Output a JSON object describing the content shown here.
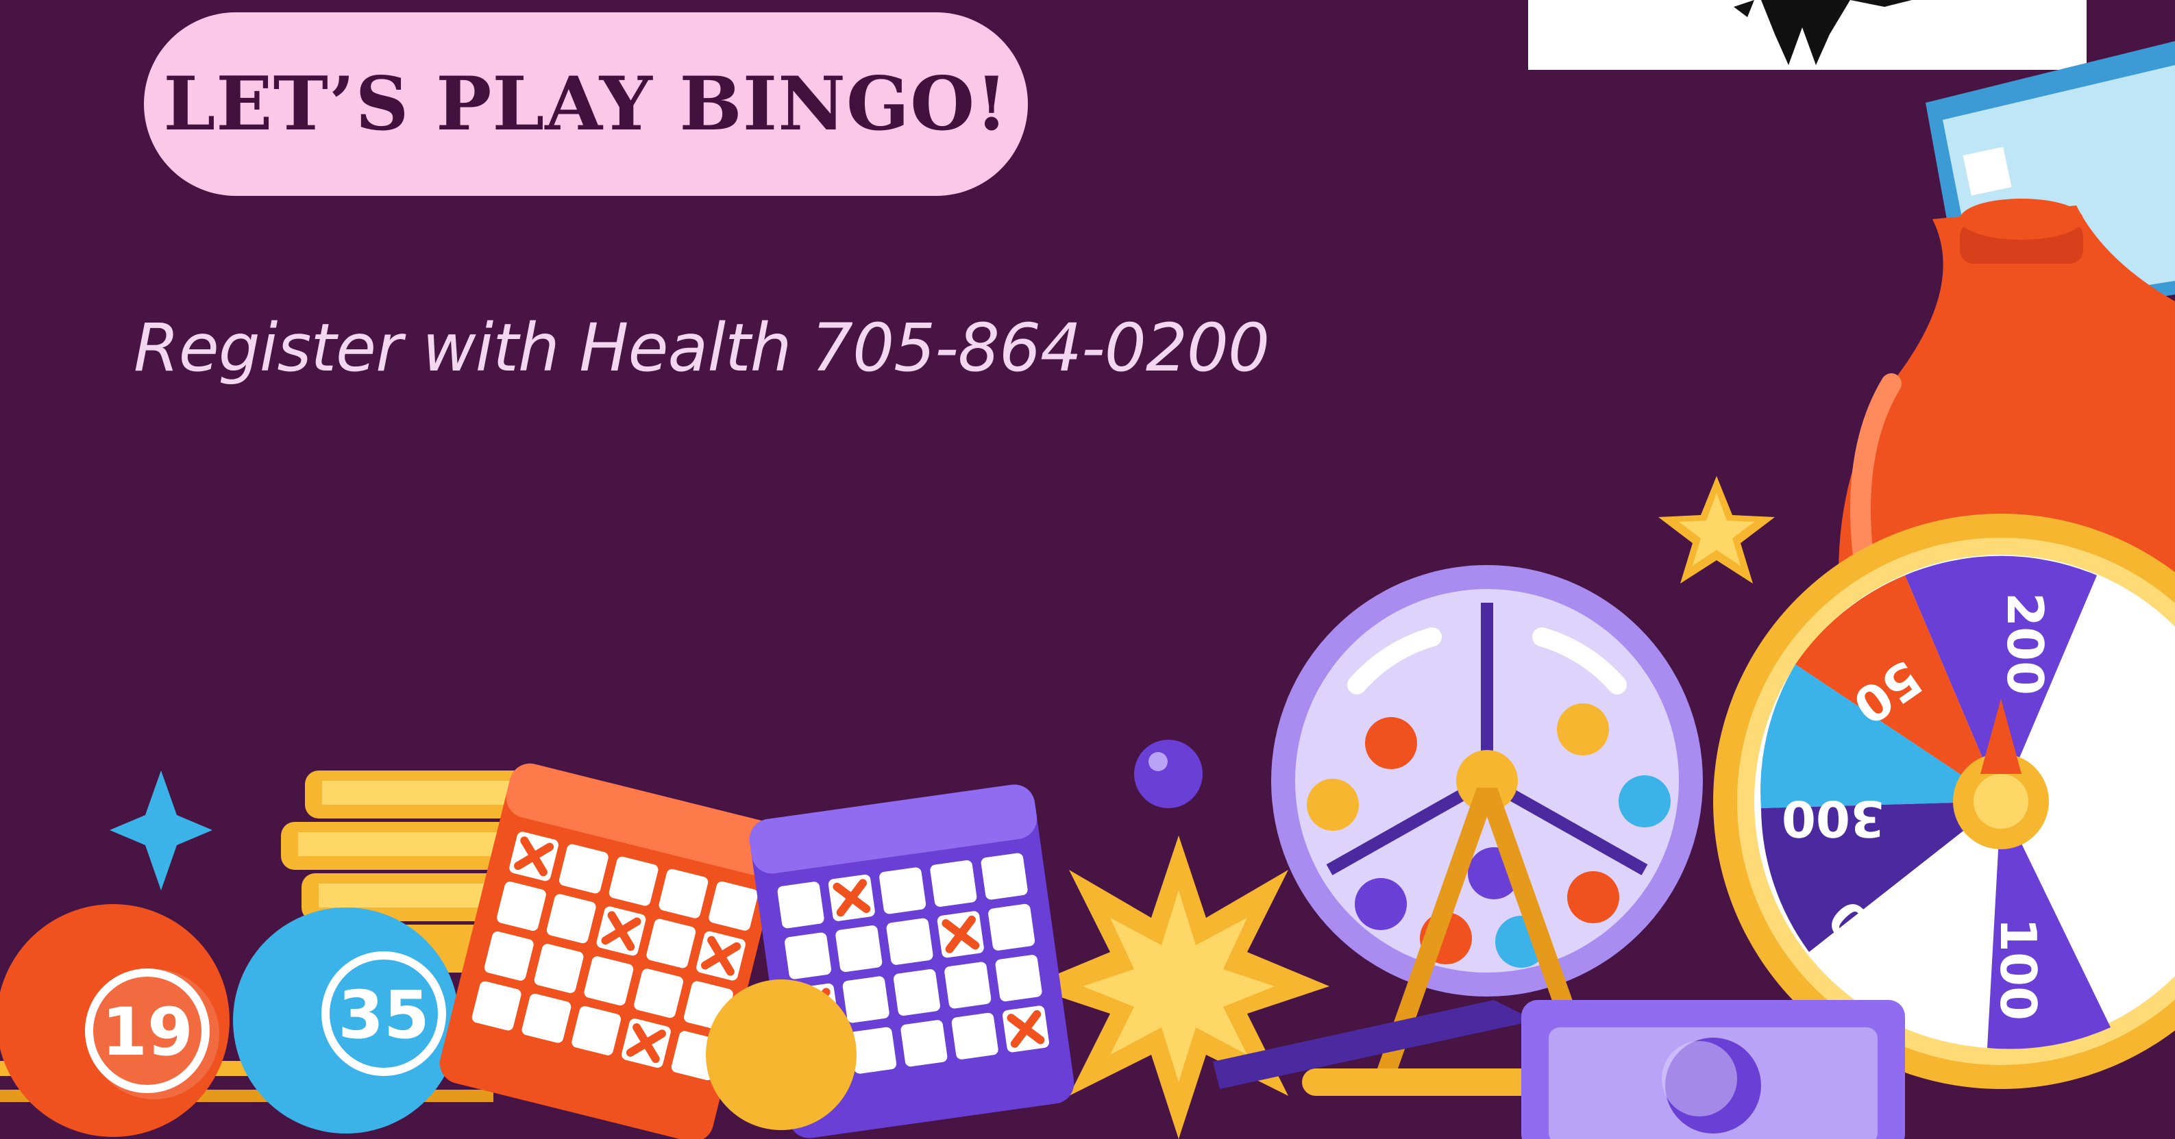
{
  "header": {
    "title": "LET’S PLAY BINGO!"
  },
  "info": {
    "register_text": "Register with Health 705-864-0200"
  },
  "bingo_balls": [
    "19",
    "35"
  ],
  "wheel_labels": [
    "200",
    "50",
    "300",
    "20",
    "100"
  ],
  "colors": {
    "background": "#481443",
    "title_pill": "#fbc8e8",
    "title_text": "#43113e",
    "subtitle": "#f3d6ef",
    "gold": "#f7b630",
    "orange": "#f0521f",
    "purple": "#6a3fd6",
    "blue": "#3bb3e8"
  },
  "icons": [
    "logo",
    "sparkle-icon",
    "star-icon",
    "coin-stack",
    "bingo-card",
    "lottery-drum",
    "prize-wheel",
    "money-bag",
    "banknote"
  ]
}
